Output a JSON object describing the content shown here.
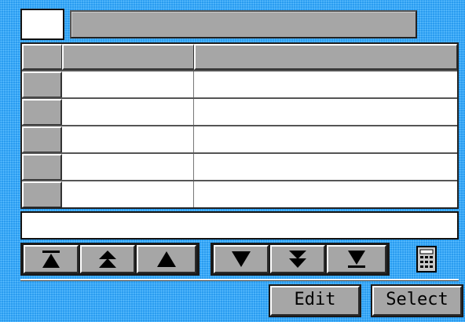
{
  "toolbar": {
    "id_field_value": "",
    "title_bar_text": ""
  },
  "table": {
    "header": [
      "",
      "",
      ""
    ],
    "rows": [
      {
        "rowhdr": "",
        "col1": "",
        "col2": ""
      },
      {
        "rowhdr": "",
        "col1": "",
        "col2": ""
      },
      {
        "rowhdr": "",
        "col1": "",
        "col2": ""
      },
      {
        "rowhdr": "",
        "col1": "",
        "col2": ""
      },
      {
        "rowhdr": "",
        "col1": "",
        "col2": ""
      }
    ]
  },
  "detail_field_value": "",
  "nav": {
    "icons": [
      "jump-first-icon",
      "page-up-icon",
      "step-up-icon",
      "step-down-icon",
      "page-down-icon",
      "jump-last-icon",
      "calculator-icon"
    ]
  },
  "buttons": {
    "edit_label": "Edit",
    "select_label": "Select"
  },
  "colors": {
    "background": "#2a9cf0",
    "button_face": "#a6a6a6",
    "field": "#ffffff"
  }
}
